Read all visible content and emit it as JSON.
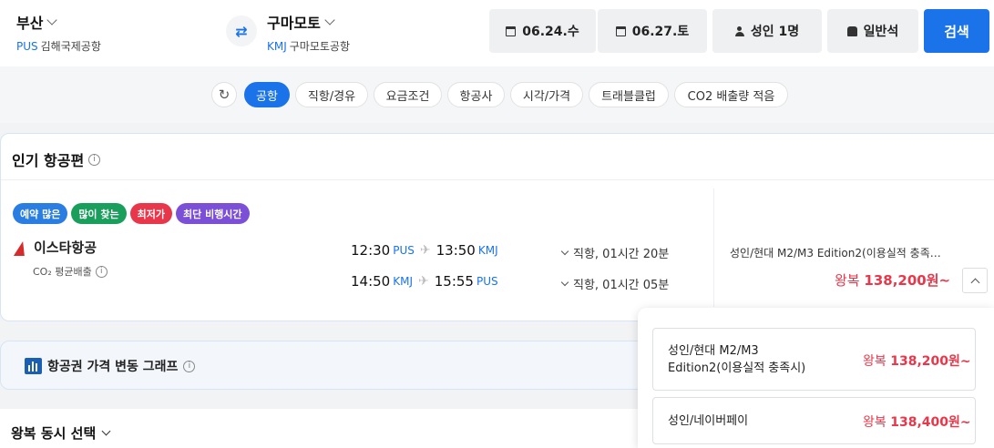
{
  "header": {
    "origin": {
      "city": "부산",
      "code": "PUS",
      "airport": "김해국제공항"
    },
    "destination": {
      "city": "구마모토",
      "code": "KMJ",
      "airport": "구마모토공항"
    },
    "depart_date": "06.24.수",
    "return_date": "06.27.토",
    "passengers": "성인 1명",
    "seat_class": "일반석",
    "search_label": "검색"
  },
  "filters": {
    "active_index": 0,
    "chips": [
      "공항",
      "직항/경유",
      "요금조건",
      "항공사",
      "시각/가격",
      "트래블클럽",
      "CO2 배출량 적음"
    ]
  },
  "popular": {
    "title": "인기 항공편",
    "badges": [
      {
        "label": "예약 많은",
        "color": "#2a7de1"
      },
      {
        "label": "많이 찾는",
        "color": "#1a9e5c"
      },
      {
        "label": "최저가",
        "color": "#e8374a"
      },
      {
        "label": "최단 비행시간",
        "color": "#7b4fd6"
      }
    ],
    "airline": "이스타항공",
    "co2": "CO₂ 평균배출",
    "legs": [
      {
        "dep_time": "12:30",
        "dep_code": "PUS",
        "arr_time": "13:50",
        "arr_code": "KMJ",
        "duration": "직항, 01시간 20분"
      },
      {
        "dep_time": "14:50",
        "dep_code": "KMJ",
        "arr_time": "15:55",
        "arr_code": "PUS",
        "duration": "직항, 01시간 05분"
      }
    ],
    "fare_desc": "성인/현대 M2/M3 Edition2(이용실적 충족…",
    "fare_prefix": "왕복",
    "fare_amount": "138,200원~"
  },
  "graph": {
    "label": "항공권 가격 변동 그래프"
  },
  "round_trip": {
    "label": "왕복 동시 선택"
  },
  "fare_options": [
    {
      "line1": "성인/현대 M2/M3",
      "line2": "Edition2(이용실적 충족시)",
      "prefix": "왕복",
      "amount": "138,200원~"
    },
    {
      "line1": "성인/네이버페이",
      "line2": "",
      "prefix": "왕복",
      "amount": "138,400원~"
    }
  ]
}
